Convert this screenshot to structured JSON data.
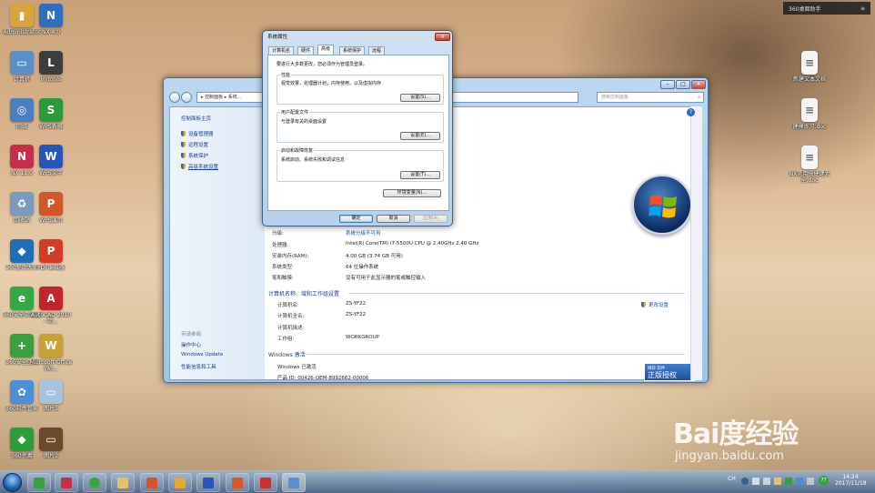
{
  "desktop": {
    "left_icons": [
      {
        "label": "Administrator",
        "color": "#d9a43c",
        "glyph": "▮"
      },
      {
        "label": "NX 4.0",
        "color": "#2f6fc2",
        "glyph": "N"
      },
      {
        "label": "计算机",
        "color": "#5b8fc9",
        "glyph": "▭"
      },
      {
        "label": "lmtools",
        "color": "#3d3d3d",
        "glyph": "L"
      },
      {
        "label": "网络",
        "color": "#4a7fc0",
        "glyph": "◎"
      },
      {
        "label": "WPS表格",
        "color": "#2a9a3a",
        "glyph": "S"
      },
      {
        "label": "NX 11.0",
        "color": "#c62f4a",
        "glyph": "N"
      },
      {
        "label": "WPS文字",
        "color": "#2656b8",
        "glyph": "W"
      },
      {
        "label": "回收站",
        "color": "#7a9bbb",
        "glyph": "♻"
      },
      {
        "label": "WPS演示",
        "color": "#d2562a",
        "glyph": "P"
      },
      {
        "label": "360驱动大师",
        "color": "#1f6fb8",
        "glyph": "◆"
      },
      {
        "label": "PDF编辑器",
        "color": "#d33b2b",
        "glyph": "P"
      },
      {
        "label": "360安全浏览器",
        "color": "#35a845",
        "glyph": "e"
      },
      {
        "label": "AutoCAD 2010 - 简...",
        "color": "#c1242c",
        "glyph": "A"
      },
      {
        "label": "360安全卫士",
        "color": "#3aa03f",
        "glyph": "+"
      },
      {
        "label": "Microsoft Office Wo...",
        "color": "#c8a038",
        "glyph": "W"
      },
      {
        "label": "360软件管家",
        "color": "#4b8fd6",
        "glyph": "✿"
      },
      {
        "label": "图片1",
        "color": "#a8c2dc",
        "glyph": "▭"
      },
      {
        "label": "360杀毒",
        "color": "#2e9b3c",
        "glyph": "◆"
      },
      {
        "label": "图片2",
        "color": "#6a4a2c",
        "glyph": "▭"
      }
    ],
    "right_icons": [
      {
        "label": "新建文本文档",
        "color": "#f5f5f5",
        "glyph": "≡"
      },
      {
        "label": "建模练习.doc",
        "color": "#f5f5f5",
        "glyph": "≡"
      },
      {
        "label": "NX常用快捷键大全.doc",
        "color": "#f5f5f5",
        "glyph": "≡"
      }
    ],
    "widget_360": "360桌面助手",
    "widget_icon": "≡"
  },
  "control_panel": {
    "address": "▸ 控制面板 ▸ 系统...",
    "search_placeholder": "搜索控制面板",
    "search_icon": "⌕",
    "side": {
      "home": "控制面板主页",
      "links": [
        "设备管理器",
        "远程设置",
        "系统保护",
        "高级系统设置"
      ],
      "see_also": "另请参阅",
      "see_also_links": [
        "操作中心",
        "Windows Update",
        "性能信息和工具"
      ]
    },
    "system": {
      "rating_key": "分级:",
      "rating_val": "系统分级不可用",
      "cpu_key": "处理器:",
      "cpu_val": "Intel(R) Core(TM) i7-5500U CPU @ 2.40GHz   2.40 GHz",
      "ram_key": "安装内存(RAM):",
      "ram_val": "4.00 GB (3.74 GB 可用)",
      "type_key": "系统类型:",
      "type_val": "64 位操作系统",
      "pen_key": "笔和触摸:",
      "pen_val": "没有可用于此显示器的笔或触控输入"
    },
    "computer": {
      "header": "计算机名称、域和工作组设置",
      "name_key": "计算机名:",
      "name_val": "ZS-YF22",
      "full_key": "计算机全名:",
      "full_val": "ZS-YF22",
      "desc_key": "计算机描述:",
      "wg_key": "工作组:",
      "wg_val": "WORKGROUP",
      "change": "更改设置"
    },
    "activation": {
      "header": "Windows 激活",
      "status": "Windows 已激活",
      "product_id": "产品 ID: 00426-OEM-8992662-00006",
      "badge_top": "微软 软件",
      "badge": "正版授权"
    }
  },
  "dialog": {
    "title": "系统属性",
    "tabs": [
      "计算机名",
      "硬件",
      "高级",
      "系统保护",
      "远程"
    ],
    "admin_note": "要进行大多数更改，您必须作为管理员登录。",
    "perf_title": "性能",
    "perf_desc": "视觉效果，处理器计划，内存使用，以及虚拟内存",
    "profile_title": "用户配置文件",
    "profile_desc": "与登录有关的桌面设置",
    "startup_title": "启动和故障恢复",
    "startup_desc": "系统启动、系统失败和调试信息",
    "settings_btn": "设置(S)...",
    "settings_btn_e": "设置(E)...",
    "settings_btn_t": "设置(T)...",
    "env_btn": "环境变量(N)...",
    "ok": "确定",
    "cancel": "取消",
    "apply": "应用(A)"
  },
  "taskbar": {
    "lang": "CH",
    "time": "14:24",
    "date": "2017/11/18",
    "tray_badge": "77"
  },
  "watermark": {
    "word": "Bai度经验",
    "url": "jingyan.baidu.com"
  }
}
